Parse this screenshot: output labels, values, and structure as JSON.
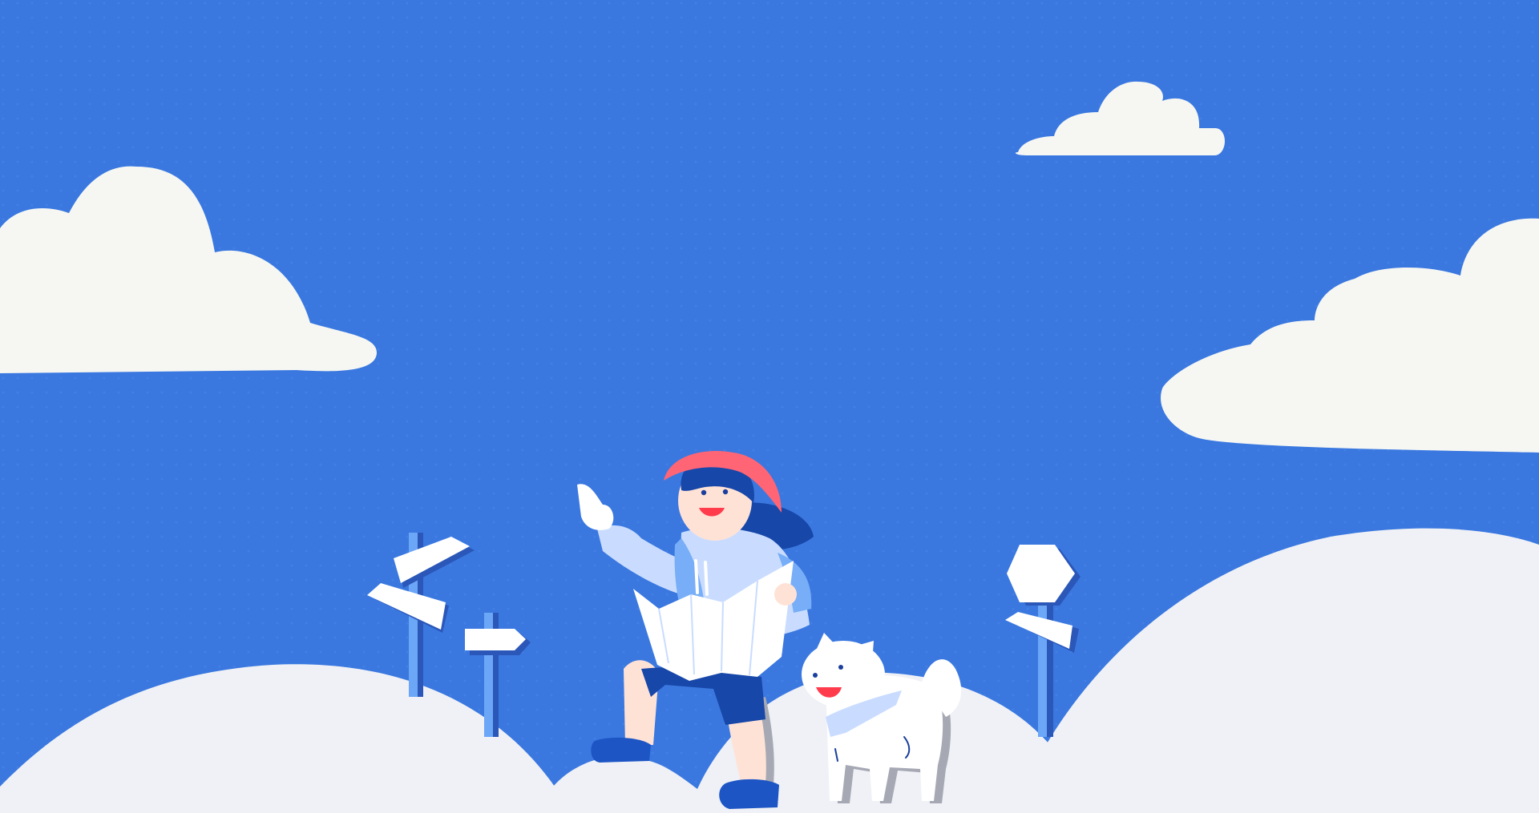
{
  "scene": {
    "subject": "person-with-map-and-dog",
    "icons": [
      "cloud-icon",
      "signpost-icon",
      "hexagon-sign-icon",
      "dog-icon",
      "map-icon"
    ]
  },
  "colors": {
    "sky": "#3a78e0",
    "sky_dot": "#4a86e8",
    "cloud": "#f6f7f3",
    "hill": "#eff1f6",
    "hat": "#ff6575",
    "hair": "#1747a8",
    "hoodie": "#c9dcff",
    "hoodie_dark": "#77aef7",
    "skin": "#ffe2d6",
    "shorts": "#1747a8",
    "shoe": "#1d55c5",
    "post": "#6ba6f7",
    "post_shadow": "#2a57b8",
    "white": "#ffffff",
    "shadow_grey": "#a6a9b4",
    "mouth": "#ff3b4c",
    "outline": "#1b3f9c"
  }
}
